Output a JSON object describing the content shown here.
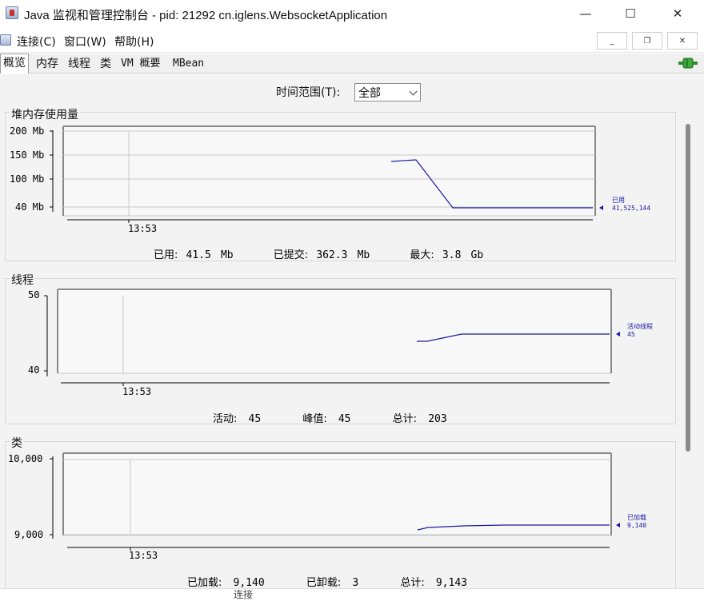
{
  "window": {
    "title": "Java 监视和管理控制台 - pid: 21292 cn.iglens.WebsocketApplication",
    "minimize": "—",
    "maximize": "☐",
    "close": "✕"
  },
  "menu": {
    "items": [
      "连接(C)",
      "窗口(W)",
      "帮助(H)"
    ],
    "inner_minimize": "_",
    "inner_restore": "❐",
    "inner_close": "✕"
  },
  "tabs": [
    "概览",
    "内存",
    "线程",
    "类",
    "VM 概要",
    "MBean"
  ],
  "active_tab": "概览",
  "range": {
    "label": "时间范围(T):",
    "value": "全部"
  },
  "heap": {
    "title": "堆内存使用量",
    "y_ticks": [
      "200 Mb",
      "150 Mb",
      "100 Mb",
      "40 Mb"
    ],
    "x_tick": "13:53",
    "legend_name": "已用",
    "legend_value": "41,525,144",
    "summary": {
      "used_label": "已用:",
      "used_value": "41.5",
      "used_unit": "Mb",
      "committed_label": "已提交:",
      "committed_value": "362.3",
      "committed_unit": "Mb",
      "max_label": "最大:",
      "max_value": "3.8",
      "max_unit": "Gb"
    }
  },
  "threads": {
    "title": "线程",
    "y_ticks": [
      "50",
      "40"
    ],
    "x_tick": "13:53",
    "legend_name": "活动线程",
    "legend_value": "45",
    "summary": {
      "live_label": "活动:",
      "live_value": "45",
      "peak_label": "峰值:",
      "peak_value": "45",
      "total_label": "总计:",
      "total_value": "203"
    }
  },
  "classes": {
    "title": "类",
    "y_ticks": [
      "10,000",
      "9,000"
    ],
    "x_tick": "13:53",
    "legend_name": "已加载",
    "legend_value": "9,140",
    "summary": {
      "loaded_label": "已加载:",
      "loaded_value": "9,140",
      "unloaded_label": "已卸载:",
      "unloaded_value": "3",
      "total_label": "总计:",
      "total_value": "9,143"
    }
  },
  "bottom_fragment": "连接",
  "colors": {
    "series": "#1a1aa0",
    "grid": "#c8c8c8",
    "plot_bg": "#f8f8f8",
    "panel_bg": "#f3f3f3"
  },
  "chart_data": [
    {
      "type": "line",
      "title": "堆内存使用量",
      "xlabel": "",
      "ylabel": "",
      "yticks": [
        "200 Mb",
        "150 Mb",
        "100 Mb",
        "40 Mb"
      ],
      "xticks": [
        "13:53"
      ],
      "series": [
        {
          "name": "已用",
          "x_rel": [
            0.0,
            0.06,
            0.14,
            0.19,
            1.0
          ],
          "values_mb": [
            137,
            140,
            40,
            40,
            40
          ]
        }
      ]
    },
    {
      "type": "line",
      "title": "线程",
      "yticks": [
        "50",
        "40"
      ],
      "xticks": [
        "13:53"
      ],
      "series": [
        {
          "name": "活动线程",
          "x_rel": [
            0.0,
            0.05,
            0.22,
            1.0
          ],
          "values": [
            44,
            44,
            45,
            45
          ]
        }
      ]
    },
    {
      "type": "line",
      "title": "类",
      "yticks": [
        "10,000",
        "9,000"
      ],
      "xticks": [
        "13:53"
      ],
      "series": [
        {
          "name": "已加载",
          "x_rel": [
            0.0,
            0.05,
            0.25,
            0.5,
            1.0
          ],
          "values": [
            9070,
            9100,
            9120,
            9135,
            9140
          ]
        }
      ]
    }
  ]
}
